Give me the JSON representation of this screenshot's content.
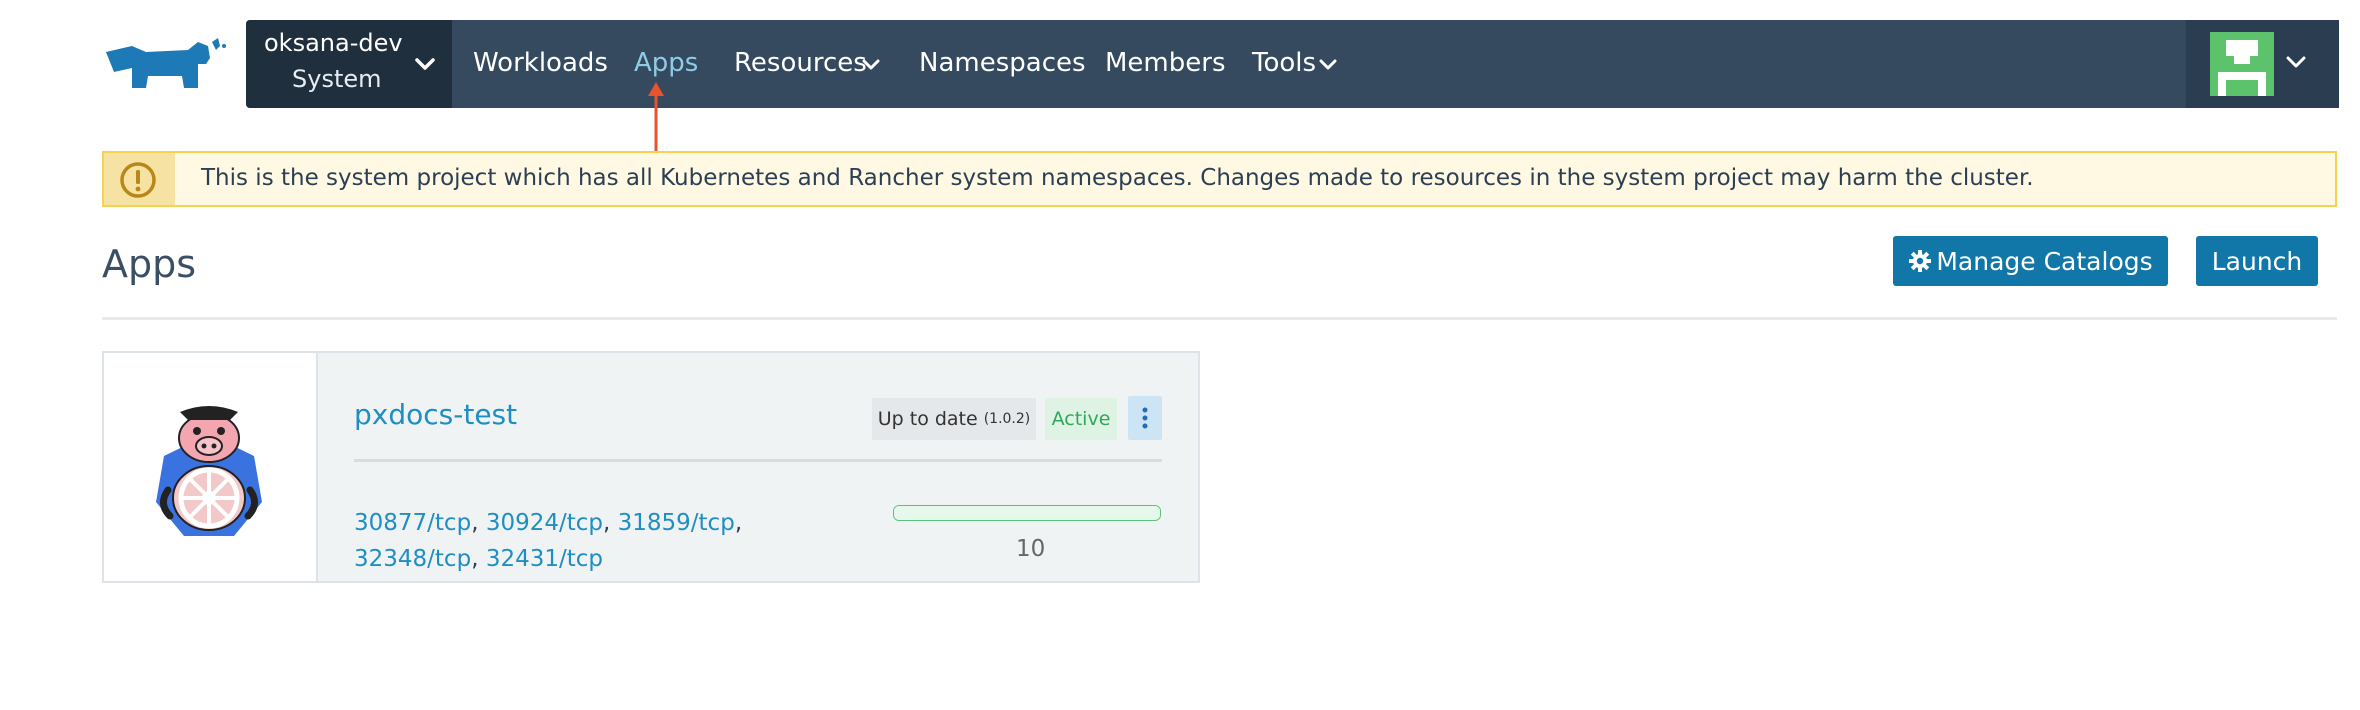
{
  "header": {
    "cluster_name": "oksana-dev",
    "project_name": "System",
    "nav": [
      {
        "label": "Workloads",
        "active": false
      },
      {
        "label": "Apps",
        "active": true
      },
      {
        "label": "Resources",
        "has_dropdown": true
      },
      {
        "label": "Namespaces"
      },
      {
        "label": "Members"
      },
      {
        "label": "Tools",
        "has_dropdown": true
      }
    ],
    "brand_color": "#1176a8",
    "navbar_color": "#354a5f"
  },
  "banner": {
    "icon": "info-circle-icon",
    "text": "This is the system project which has all Kubernetes and Rancher system namespaces. Changes made to resources in the system project may harm the cluster."
  },
  "page": {
    "title": "Apps",
    "buttons": {
      "manage_catalogs": "Manage Catalogs",
      "launch": "Launch"
    }
  },
  "app": {
    "name": "pxdocs-test",
    "update_status": "Up to date",
    "version": "(1.0.2)",
    "state": "Active",
    "ports": [
      "30877/tcp",
      "30924/tcp",
      "31859/tcp",
      "32348/tcp",
      "32431/tcp"
    ],
    "pod_count": "10",
    "progress_fraction": 1.0
  },
  "colors": {
    "link": "#1f8ec3",
    "active_green": "#2fa85a",
    "warning_border": "#f5d252",
    "annotation_arrow": "#e8532b"
  }
}
